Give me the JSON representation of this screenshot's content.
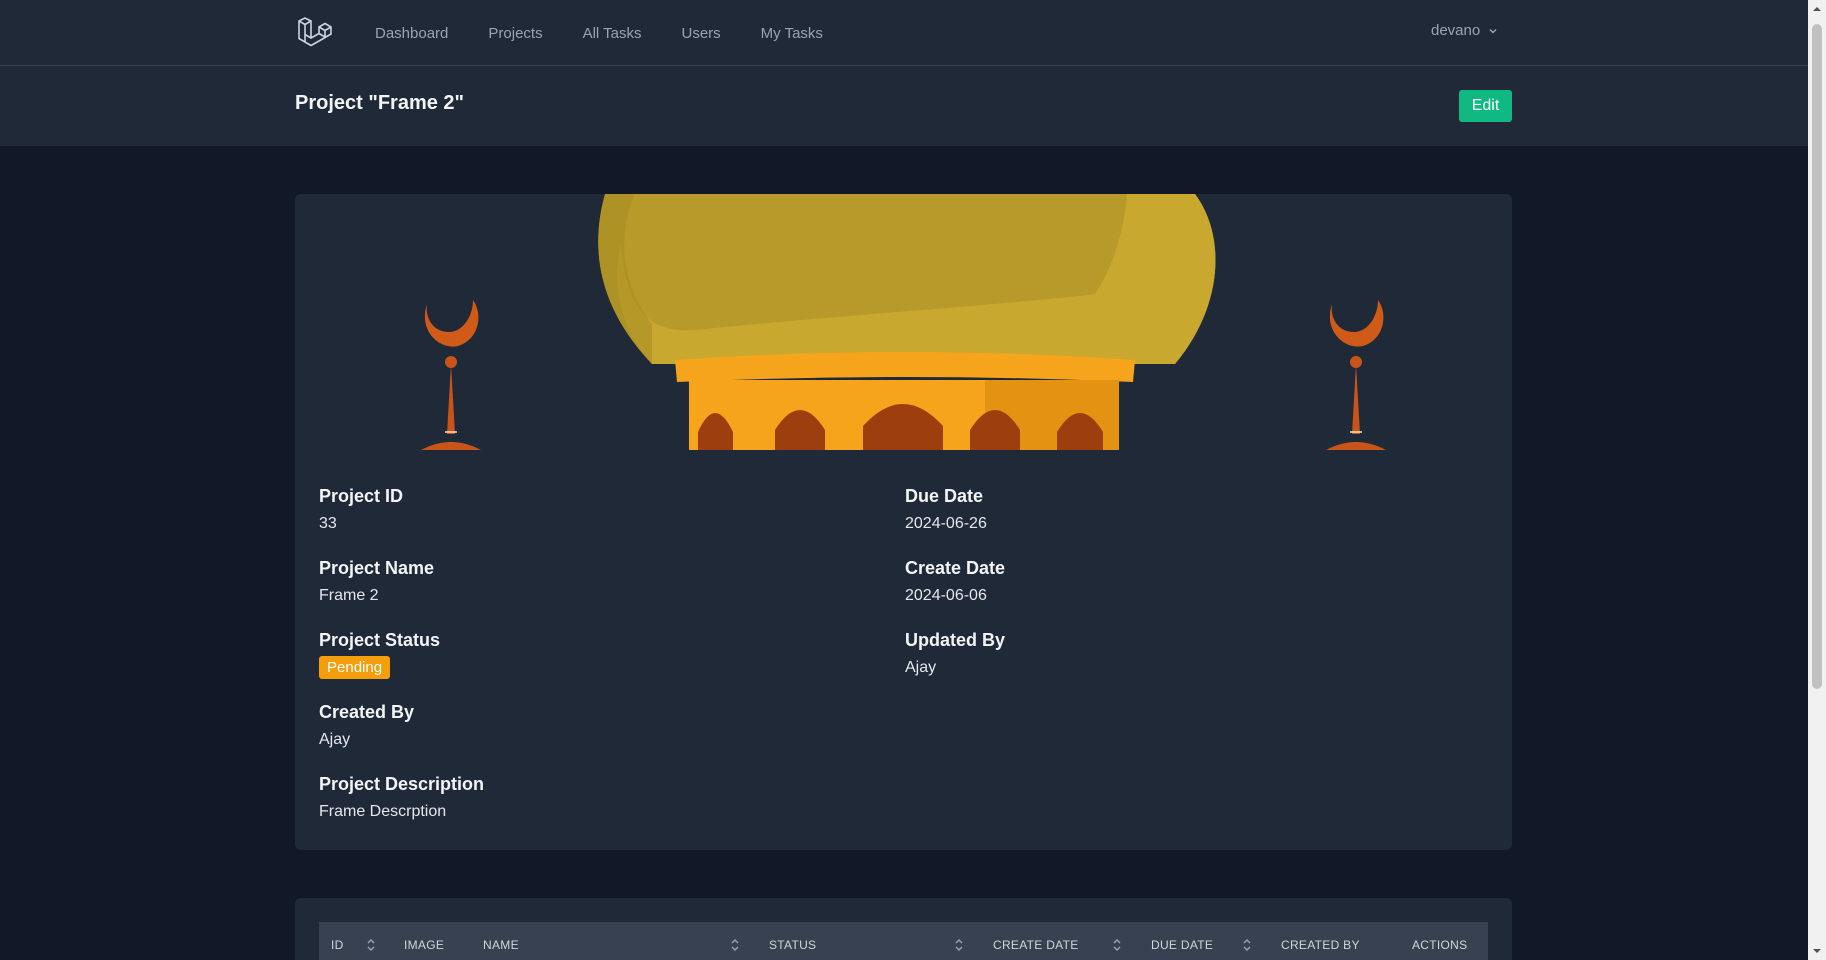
{
  "nav": {
    "links": [
      "Dashboard",
      "Projects",
      "All Tasks",
      "Users",
      "My Tasks"
    ],
    "user": "devano",
    "logo_icon": "laravel-logo-icon"
  },
  "header": {
    "title": "Project \"Frame 2\"",
    "edit_label": "Edit"
  },
  "project": {
    "left": [
      {
        "label": "Project ID",
        "value": "33"
      },
      {
        "label": "Project Name",
        "value": "Frame 2"
      },
      {
        "label": "Project Status",
        "value": "Pending"
      },
      {
        "label": "Created By",
        "value": "Ajay"
      },
      {
        "label": "Project Description",
        "value": "Frame Descrption"
      }
    ],
    "right": [
      {
        "label": "Due Date",
        "value": "2024-06-26"
      },
      {
        "label": "Create Date",
        "value": "2024-06-06"
      },
      {
        "label": "Updated By",
        "value": "Ajay"
      }
    ]
  },
  "table": {
    "columns": [
      "ID",
      "Image",
      "Name",
      "Status",
      "Create Date",
      "Due Date",
      "Created By",
      "Actions"
    ]
  },
  "colors": {
    "accent_edit": "#10b981",
    "badge_pending": "#f59e0b",
    "background": "#111827",
    "panel": "#1f2937"
  }
}
